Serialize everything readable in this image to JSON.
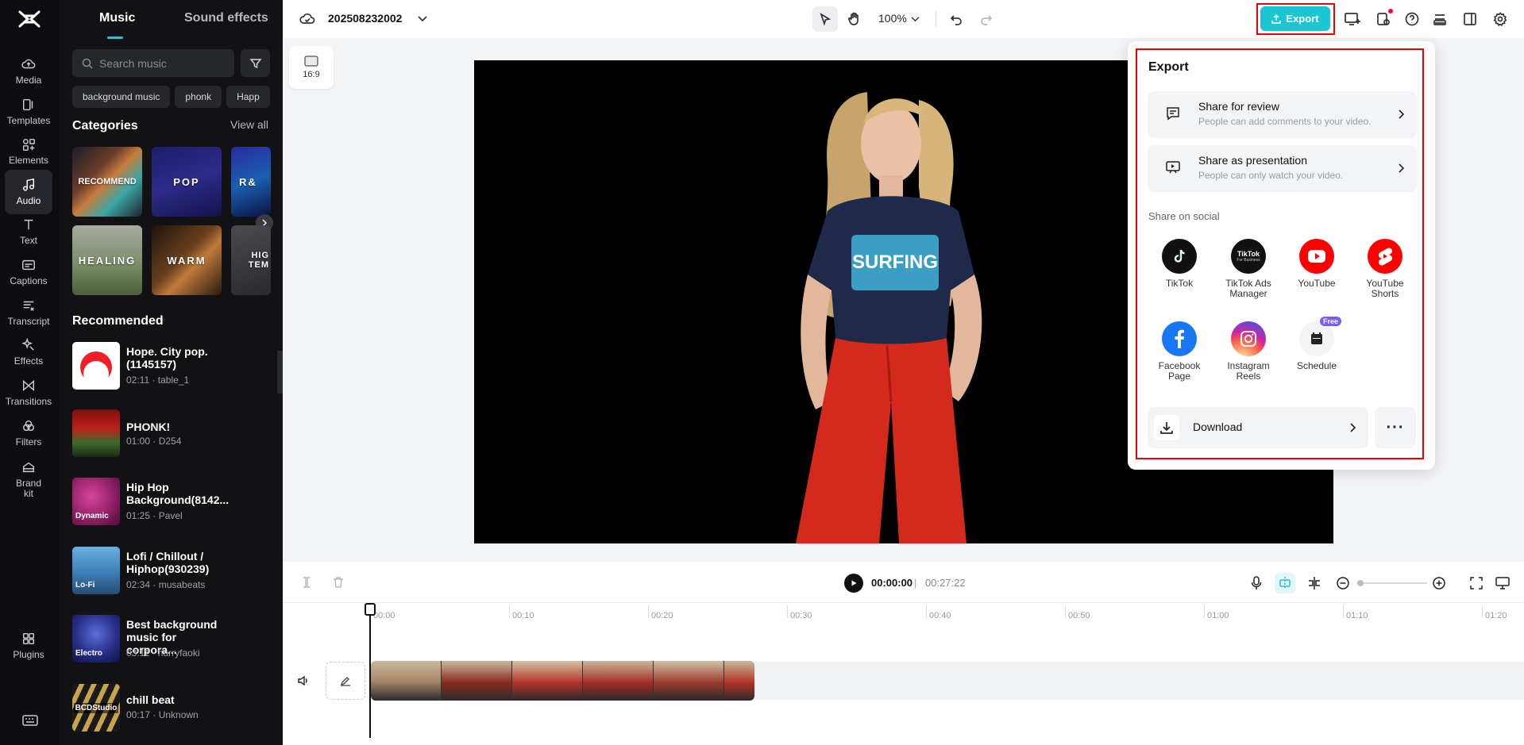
{
  "sidebar": {
    "items": [
      {
        "label": "Media",
        "icon": "cloud-icon"
      },
      {
        "label": "Templates",
        "icon": "template-icon"
      },
      {
        "label": "Elements",
        "icon": "elements-icon"
      },
      {
        "label": "Audio",
        "icon": "music-note-icon",
        "active": true
      },
      {
        "label": "Text",
        "icon": "text-icon"
      },
      {
        "label": "Captions",
        "icon": "captions-icon"
      },
      {
        "label": "Transcript",
        "icon": "transcript-icon"
      },
      {
        "label": "Effects",
        "icon": "effects-icon"
      },
      {
        "label": "Transitions",
        "icon": "transitions-icon"
      },
      {
        "label": "Filters",
        "icon": "filters-icon"
      },
      {
        "label": "Brand kit",
        "icon": "brand-kit-icon"
      },
      {
        "label": "Plugins",
        "icon": "plugins-icon"
      }
    ]
  },
  "panel": {
    "tabs": [
      "Music",
      "Sound effects"
    ],
    "search_placeholder": "Search music",
    "chips": [
      "background music",
      "phonk",
      "Happ"
    ],
    "categories_title": "Categories",
    "view_all": "View all",
    "categories": [
      "RECOMMEND",
      "POP",
      "R&",
      "HEALING",
      "WARM",
      "HIG TEM"
    ],
    "recommended_title": "Recommended",
    "tracks": [
      {
        "name": "Hope. City pop.(1145157)",
        "meta": "02:11 · table_1",
        "thumb_label": ""
      },
      {
        "name": "PHONK!",
        "meta": "01:00 · D254",
        "thumb_label": ""
      },
      {
        "name": "Hip Hop Background(8142...",
        "meta": "01:25 · Pavel",
        "thumb_label": "Dynamic"
      },
      {
        "name": "Lofi / Chillout / Hiphop(930239)",
        "meta": "02:34 · musabeats",
        "thumb_label": "Lo-Fi"
      },
      {
        "name": "Best background music for corpora...",
        "meta": "03:11 · harryfaoki",
        "thumb_label": "Electro"
      },
      {
        "name": "chill beat",
        "meta": "00:17 · Unknown",
        "thumb_label": "BCDStudio"
      }
    ]
  },
  "header": {
    "project_name": "202508232002",
    "zoom": "100%",
    "export_label": "Export"
  },
  "canvas": {
    "ratio": "16:9"
  },
  "export_panel": {
    "title": "Export",
    "share_review": {
      "title": "Share for review",
      "desc": "People can add comments to your video."
    },
    "share_presentation": {
      "title": "Share as presentation",
      "desc": "People can only watch your video."
    },
    "social_title": "Share on social",
    "social": [
      {
        "label": "TikTok",
        "icon": "tiktok-icon",
        "color": "#111111"
      },
      {
        "label": "TikTok Ads Manager",
        "icon": "tiktok-ads-icon",
        "color": "#111111"
      },
      {
        "label": "YouTube",
        "icon": "youtube-icon",
        "color": "#ff0000"
      },
      {
        "label": "YouTube Shorts",
        "icon": "youtube-shorts-icon",
        "color": "#ff0000"
      },
      {
        "label": "Facebook Page",
        "icon": "facebook-icon",
        "color": "#1877f2"
      },
      {
        "label": "Instagram Reels",
        "icon": "instagram-icon",
        "color": "#d6249f"
      },
      {
        "label": "Schedule",
        "icon": "calendar-icon",
        "color": "#f3f4f6"
      }
    ],
    "tiktok_ads_logo": "TikTok",
    "tiktok_ads_logo_sub": "For Business",
    "free_badge": "Free",
    "download_label": "Download",
    "more_label": "···"
  },
  "timeline": {
    "current_time": "00:00:00",
    "separator": "|",
    "duration": "00:27:22",
    "ticks": [
      "00:00",
      "00:10",
      "00:20",
      "00:30",
      "00:40",
      "00:50",
      "01:00",
      "01:10",
      "01:20"
    ]
  },
  "colors": {
    "accent": "#1bc5d1",
    "highlight_outline": "#ee0000",
    "rail_bg": "#0e0e10",
    "panel_bg": "#121214"
  }
}
